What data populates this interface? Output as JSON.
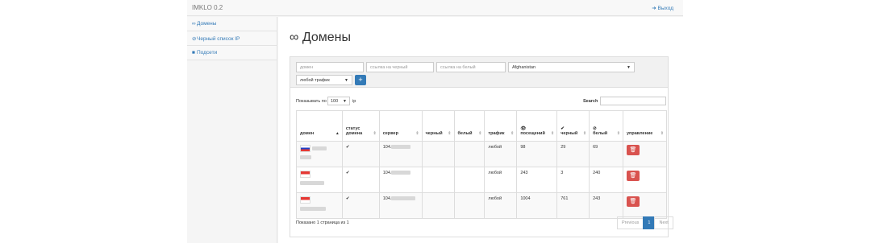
{
  "app": {
    "title": "IMKLO 0.2",
    "logout_label": "Выход",
    "logout_icon": "logout-icon"
  },
  "sidebar": {
    "items": [
      {
        "label": "Домены",
        "icon": "link-icon"
      },
      {
        "label": "Черный список IP",
        "icon": "ban-icon"
      },
      {
        "label": "Подсети",
        "icon": "square-icon"
      }
    ]
  },
  "page": {
    "title": "Домены",
    "title_icon": "link-icon"
  },
  "filters": {
    "domain_placeholder": "домен",
    "black_url_placeholder": "ссылка на черный",
    "white_url_placeholder": "ссылка на белый",
    "country_value": "Afghanistan",
    "traffic_value": "любой трафик",
    "add_label": "+"
  },
  "table_controls": {
    "show_prefix": "Показывать по",
    "page_size": "100",
    "show_suffix": "ip",
    "search_label": "Search"
  },
  "table": {
    "columns": [
      "домен",
      "статус домена",
      "сервер",
      "черный",
      "белый",
      "трафик",
      "посещений",
      "черный",
      "белый",
      "управление"
    ],
    "rows": [
      {
        "flag": "ru",
        "status": "✔",
        "server_prefix": "104.",
        "traffic": "любой",
        "visits": "98",
        "black": "29",
        "white": "69"
      },
      {
        "flag": "id",
        "status": "✔",
        "server_prefix": "104.",
        "traffic": "любой",
        "visits": "243",
        "black": "3",
        "white": "240"
      },
      {
        "flag": "id",
        "status": "✔",
        "server_prefix": "104.",
        "traffic": "любой",
        "visits": "1004",
        "black": "761",
        "white": "243"
      }
    ]
  },
  "footer": {
    "info": "Показано 1 страница из 1",
    "prev": "Previous",
    "page": "1",
    "next": "Next"
  }
}
